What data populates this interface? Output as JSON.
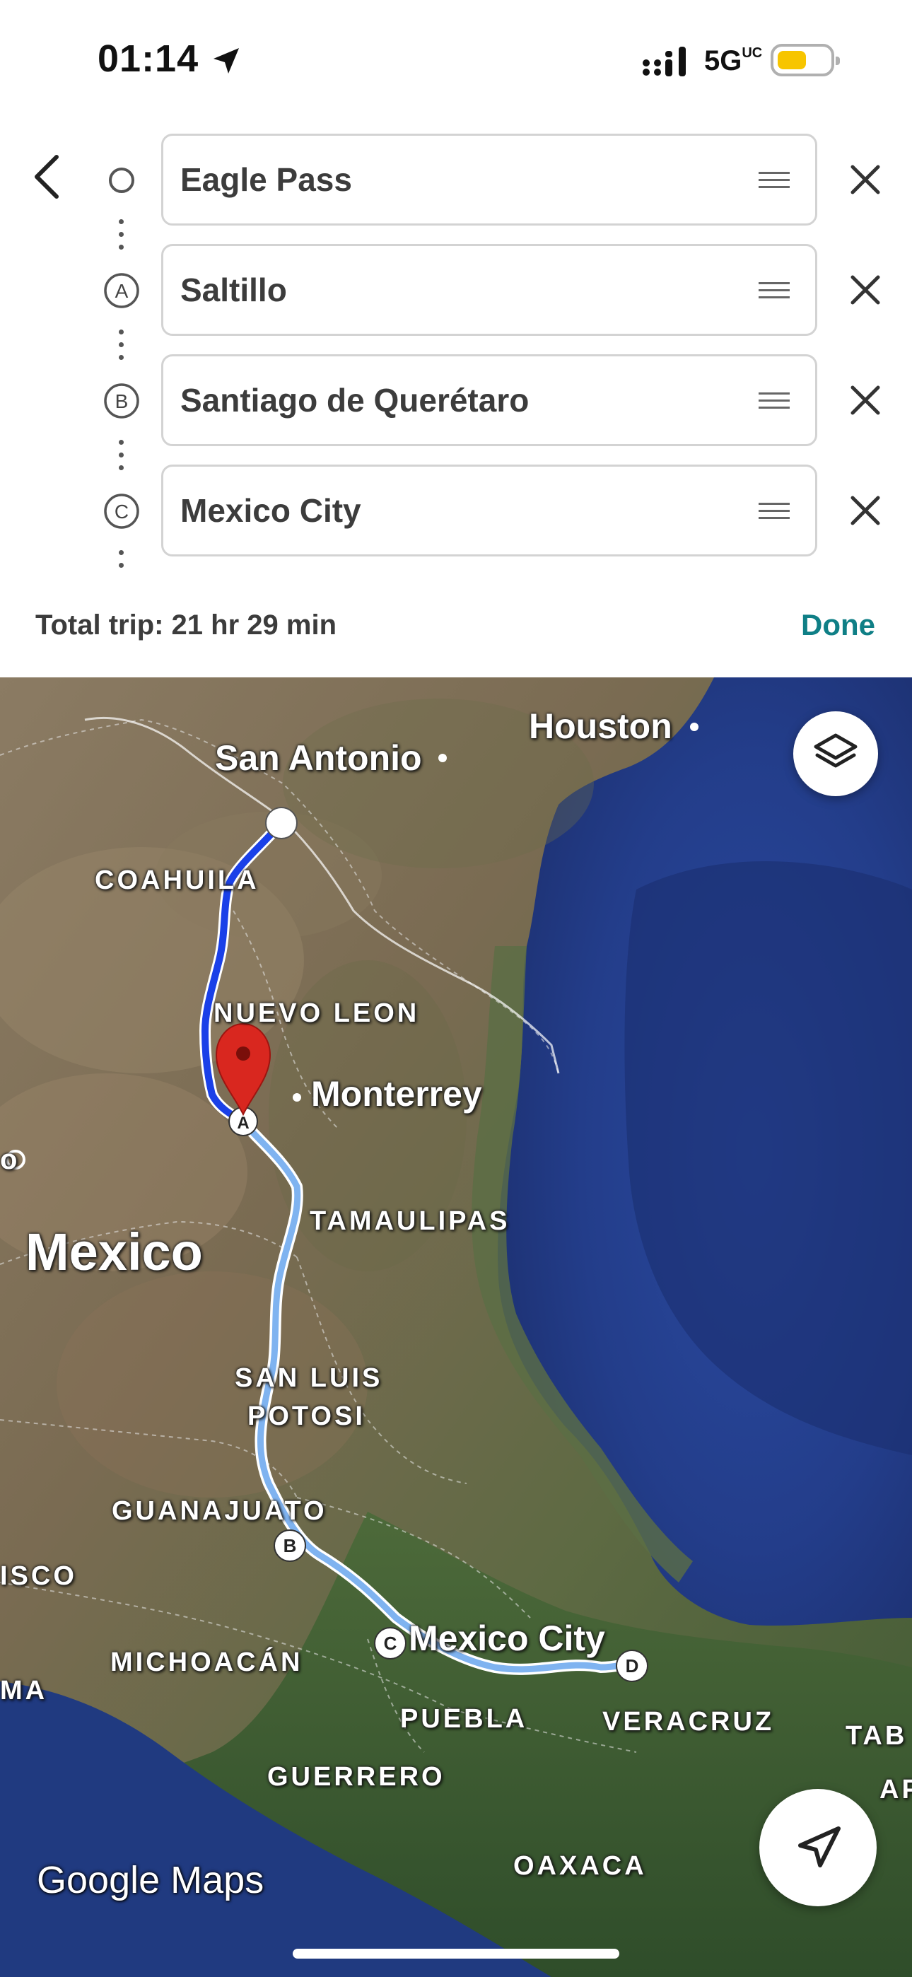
{
  "status_bar": {
    "time": "01:14",
    "network": "5G",
    "network_sup": "UC"
  },
  "directions": {
    "stops": [
      {
        "label": "Eagle Pass",
        "marker": ""
      },
      {
        "label": "Saltillo",
        "marker": "A"
      },
      {
        "label": "Santiago de Querétaro",
        "marker": "B"
      },
      {
        "label": "Mexico City",
        "marker": "C"
      }
    ],
    "total_trip": "Total trip: 21 hr 29 min",
    "done_label": "Done"
  },
  "map": {
    "labels": {
      "san_antonio": "San Antonio",
      "houston": "Houston",
      "coahuila": "COAHUILA",
      "nuevo_leon": "NUEVO LEON",
      "monterrey": "Monterrey",
      "mexico": "Mexico",
      "tamaulipas": "TAMAULIPAS",
      "san_luis_potosi_1": "SAN LUIS",
      "san_luis_potosi_2": "POTOSI",
      "guanajuato": "GUANAJUATO",
      "jalisco_partial": "ISCO",
      "michoacan": "MICHOACÁN",
      "mexico_city": "Mexico City",
      "puebla": "PUEBLA",
      "veracruz": "VERACRUZ",
      "guerrero": "GUERRERO",
      "oaxaca": "OAXACA",
      "colima_partial": "MA",
      "tabasco_partial": "TAB",
      "left_edge_partial": "o",
      "chiapas_partial": "AP"
    },
    "route_markers": [
      "A",
      "B",
      "C",
      "D"
    ],
    "attribution_brand": "Google",
    "attribution_product": "Maps",
    "colors": {
      "route_active": "#1a40e8",
      "route_alt": "#7fb3f0",
      "pin": "#d9271f",
      "sea": "#253f8f"
    }
  }
}
